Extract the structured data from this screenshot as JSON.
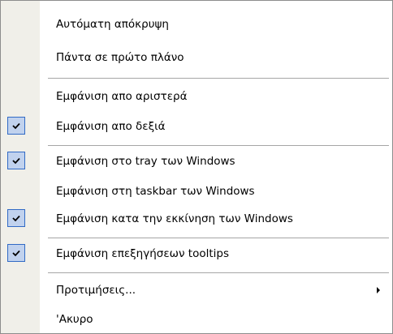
{
  "menu": {
    "items": [
      {
        "label": "Αυτόματη απόκρυψη",
        "checked": false
      },
      {
        "label": "Πάντα σε πρώτο πλάνο",
        "checked": false
      },
      {
        "label": "Εμφάνιση απο αριστερά",
        "checked": false
      },
      {
        "label": "Εμφάνιση απο δεξιά",
        "checked": true
      },
      {
        "label": "Εμφάνιση στο tray των Windows",
        "checked": true
      },
      {
        "label": "Εμφάνιση στη taskbar των Windows",
        "checked": false
      },
      {
        "label": "Εμφάνιση κατα την εκκίνηση των Windows",
        "checked": true
      },
      {
        "label": "Εμφάνιση επεξηγήσεων tooltips",
        "checked": true
      },
      {
        "label": "Προτιμήσεις...",
        "checked": false,
        "submenu": true
      },
      {
        "label": "'Ακυρο",
        "checked": false
      }
    ]
  },
  "icons": {
    "checkmark": "checkmark-icon",
    "submenu_arrow": "submenu-arrow-icon"
  },
  "colors": {
    "check_background": "#c1d2ee",
    "check_border": "#316ac5",
    "gutter": "#f0efe9"
  }
}
